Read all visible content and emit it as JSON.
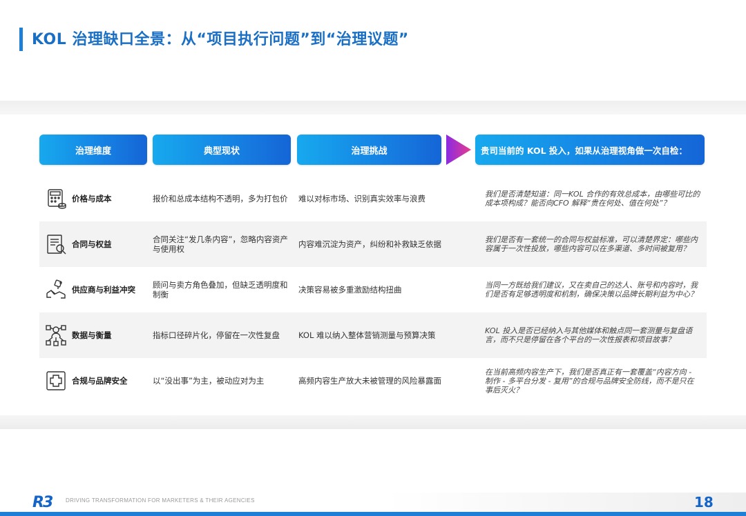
{
  "title": "KOL 治理缺口全景：从“项目执行问题”到“治理议题”",
  "headers": {
    "col1": "治理维度",
    "col2": "典型现状",
    "col3": "治理挑战",
    "col4": "贵司当前的 KOL 投入，如果从治理视角做一次自检："
  },
  "rows": [
    {
      "icon": "price-cost-icon",
      "dimension": "价格与成本",
      "current": "报价和总成本结构不透明，多为打包价",
      "challenge": "难以对标市场、识别真实效率与浪费",
      "question": "我们是否清楚知道：同一KOL 合作的有效总成本，由哪些可比的成本项构成？能否向CFO 解释“贵在何处、值在何处”？"
    },
    {
      "icon": "contract-search-icon",
      "dimension": "合同与权益",
      "current": "合同关注“发几条内容”，忽略内容资产与使用权",
      "challenge": "内容难沉淀为资产，纠纷和补救缺乏依据",
      "question": "我们是否有一套统一的合同与权益标准，可以清楚界定：哪些内容属于一次性投放，哪些内容可以在多渠道、多时间被复用？"
    },
    {
      "icon": "handshake-conflict-icon",
      "dimension": "供应商与利益冲突",
      "current": "顾问与卖方角色叠加，但缺乏透明度和制衡",
      "challenge": "决策容易被多重激励结构扭曲",
      "question": "当同一方既给我们建议，又在卖自己的达人、账号和内容时，我们是否有足够透明度和机制，确保决策以品牌长期利益为中心？"
    },
    {
      "icon": "data-network-icon",
      "dimension": "数据与衡量",
      "current": "指标口径碎片化，停留在一次性复盘",
      "challenge": "KOL 难以纳入整体营销测量与预算决策",
      "question": "KOL 投入是否已经纳入与其他媒体和触点同一套测量与复盘语言，而不只是停留在各个平台的一次性报表和项目故事？"
    },
    {
      "icon": "medical-cross-icon",
      "dimension": "合规与品牌安全",
      "current": "以“没出事”为主，被动应对为主",
      "challenge": "高频内容生产放大未被管理的风险暴露面",
      "question": "在当前高频内容生产下，我们是否真正有一套覆盖“内容方向 - 制作 - 多平台分发 - 复用”的合规与品牌安全防线，而不是只在事后灭火？"
    }
  ],
  "footer": {
    "logo": "R3",
    "tagline": "DRIVING TRANSFORMATION FOR MARKETERS & THEIR AGENCIES",
    "page_number": "18"
  },
  "colors": {
    "accent": "#1e7fd6",
    "header_gradient_start": "#17a9ee",
    "header_gradient_end": "#1565d6",
    "arrow": "#e73c8e"
  }
}
